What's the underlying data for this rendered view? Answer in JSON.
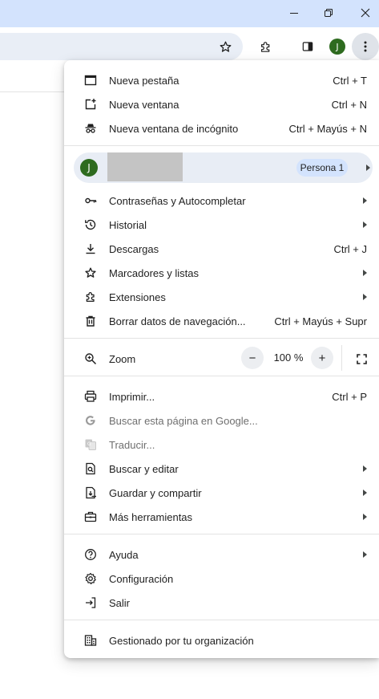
{
  "window": {
    "minimize_icon": "minimize-icon",
    "restore_icon": "restore-icon",
    "close_icon": "close-icon"
  },
  "toolbar": {
    "profile_initial": "J",
    "icons": [
      "star-icon",
      "extensions-icon",
      "side-panel-icon",
      "kebab-menu-icon"
    ]
  },
  "menu": {
    "group1": [
      {
        "label": "Nueva pestaña",
        "shortcut": "Ctrl + T",
        "icon": "new-tab-icon"
      },
      {
        "label": "Nueva ventana",
        "shortcut": "Ctrl + N",
        "icon": "new-window-icon"
      },
      {
        "label": "Nueva ventana de incógnito",
        "shortcut": "Ctrl + Mayús + N",
        "icon": "incognito-icon"
      }
    ],
    "profile": {
      "initial": "J",
      "badge": "Persona 1"
    },
    "group2": [
      {
        "label": "Contraseñas y Autocompletar",
        "icon": "key-icon",
        "submenu": true
      },
      {
        "label": "Historial",
        "icon": "history-icon",
        "submenu": true
      },
      {
        "label": "Descargas",
        "shortcut": "Ctrl + J",
        "icon": "download-icon"
      },
      {
        "label": "Marcadores y listas",
        "icon": "star-icon",
        "submenu": true
      },
      {
        "label": "Extensiones",
        "icon": "extensions-icon",
        "submenu": true
      },
      {
        "label": "Borrar datos de navegación...",
        "shortcut": "Ctrl + Mayús + Supr",
        "icon": "trash-icon"
      }
    ],
    "zoom": {
      "label": "Zoom",
      "value": "100 %",
      "minus": "−",
      "plus": "+"
    },
    "group3": [
      {
        "label": "Imprimir...",
        "shortcut": "Ctrl + P",
        "icon": "print-icon"
      },
      {
        "label": "Buscar esta página en Google...",
        "icon": "google-icon",
        "disabled": true
      },
      {
        "label": "Traducir...",
        "icon": "translate-icon",
        "disabled": true
      },
      {
        "label": "Buscar y editar",
        "icon": "find-icon",
        "submenu": true
      },
      {
        "label": "Guardar y compartir",
        "icon": "save-share-icon",
        "submenu": true
      },
      {
        "label": "Más herramientas",
        "icon": "toolbox-icon",
        "submenu": true
      }
    ],
    "group4": [
      {
        "label": "Ayuda",
        "icon": "help-icon",
        "submenu": true
      },
      {
        "label": "Configuración",
        "icon": "settings-icon"
      },
      {
        "label": "Salir",
        "icon": "exit-icon"
      }
    ],
    "managed": {
      "label": "Gestionado por tu organización",
      "icon": "building-icon"
    }
  }
}
